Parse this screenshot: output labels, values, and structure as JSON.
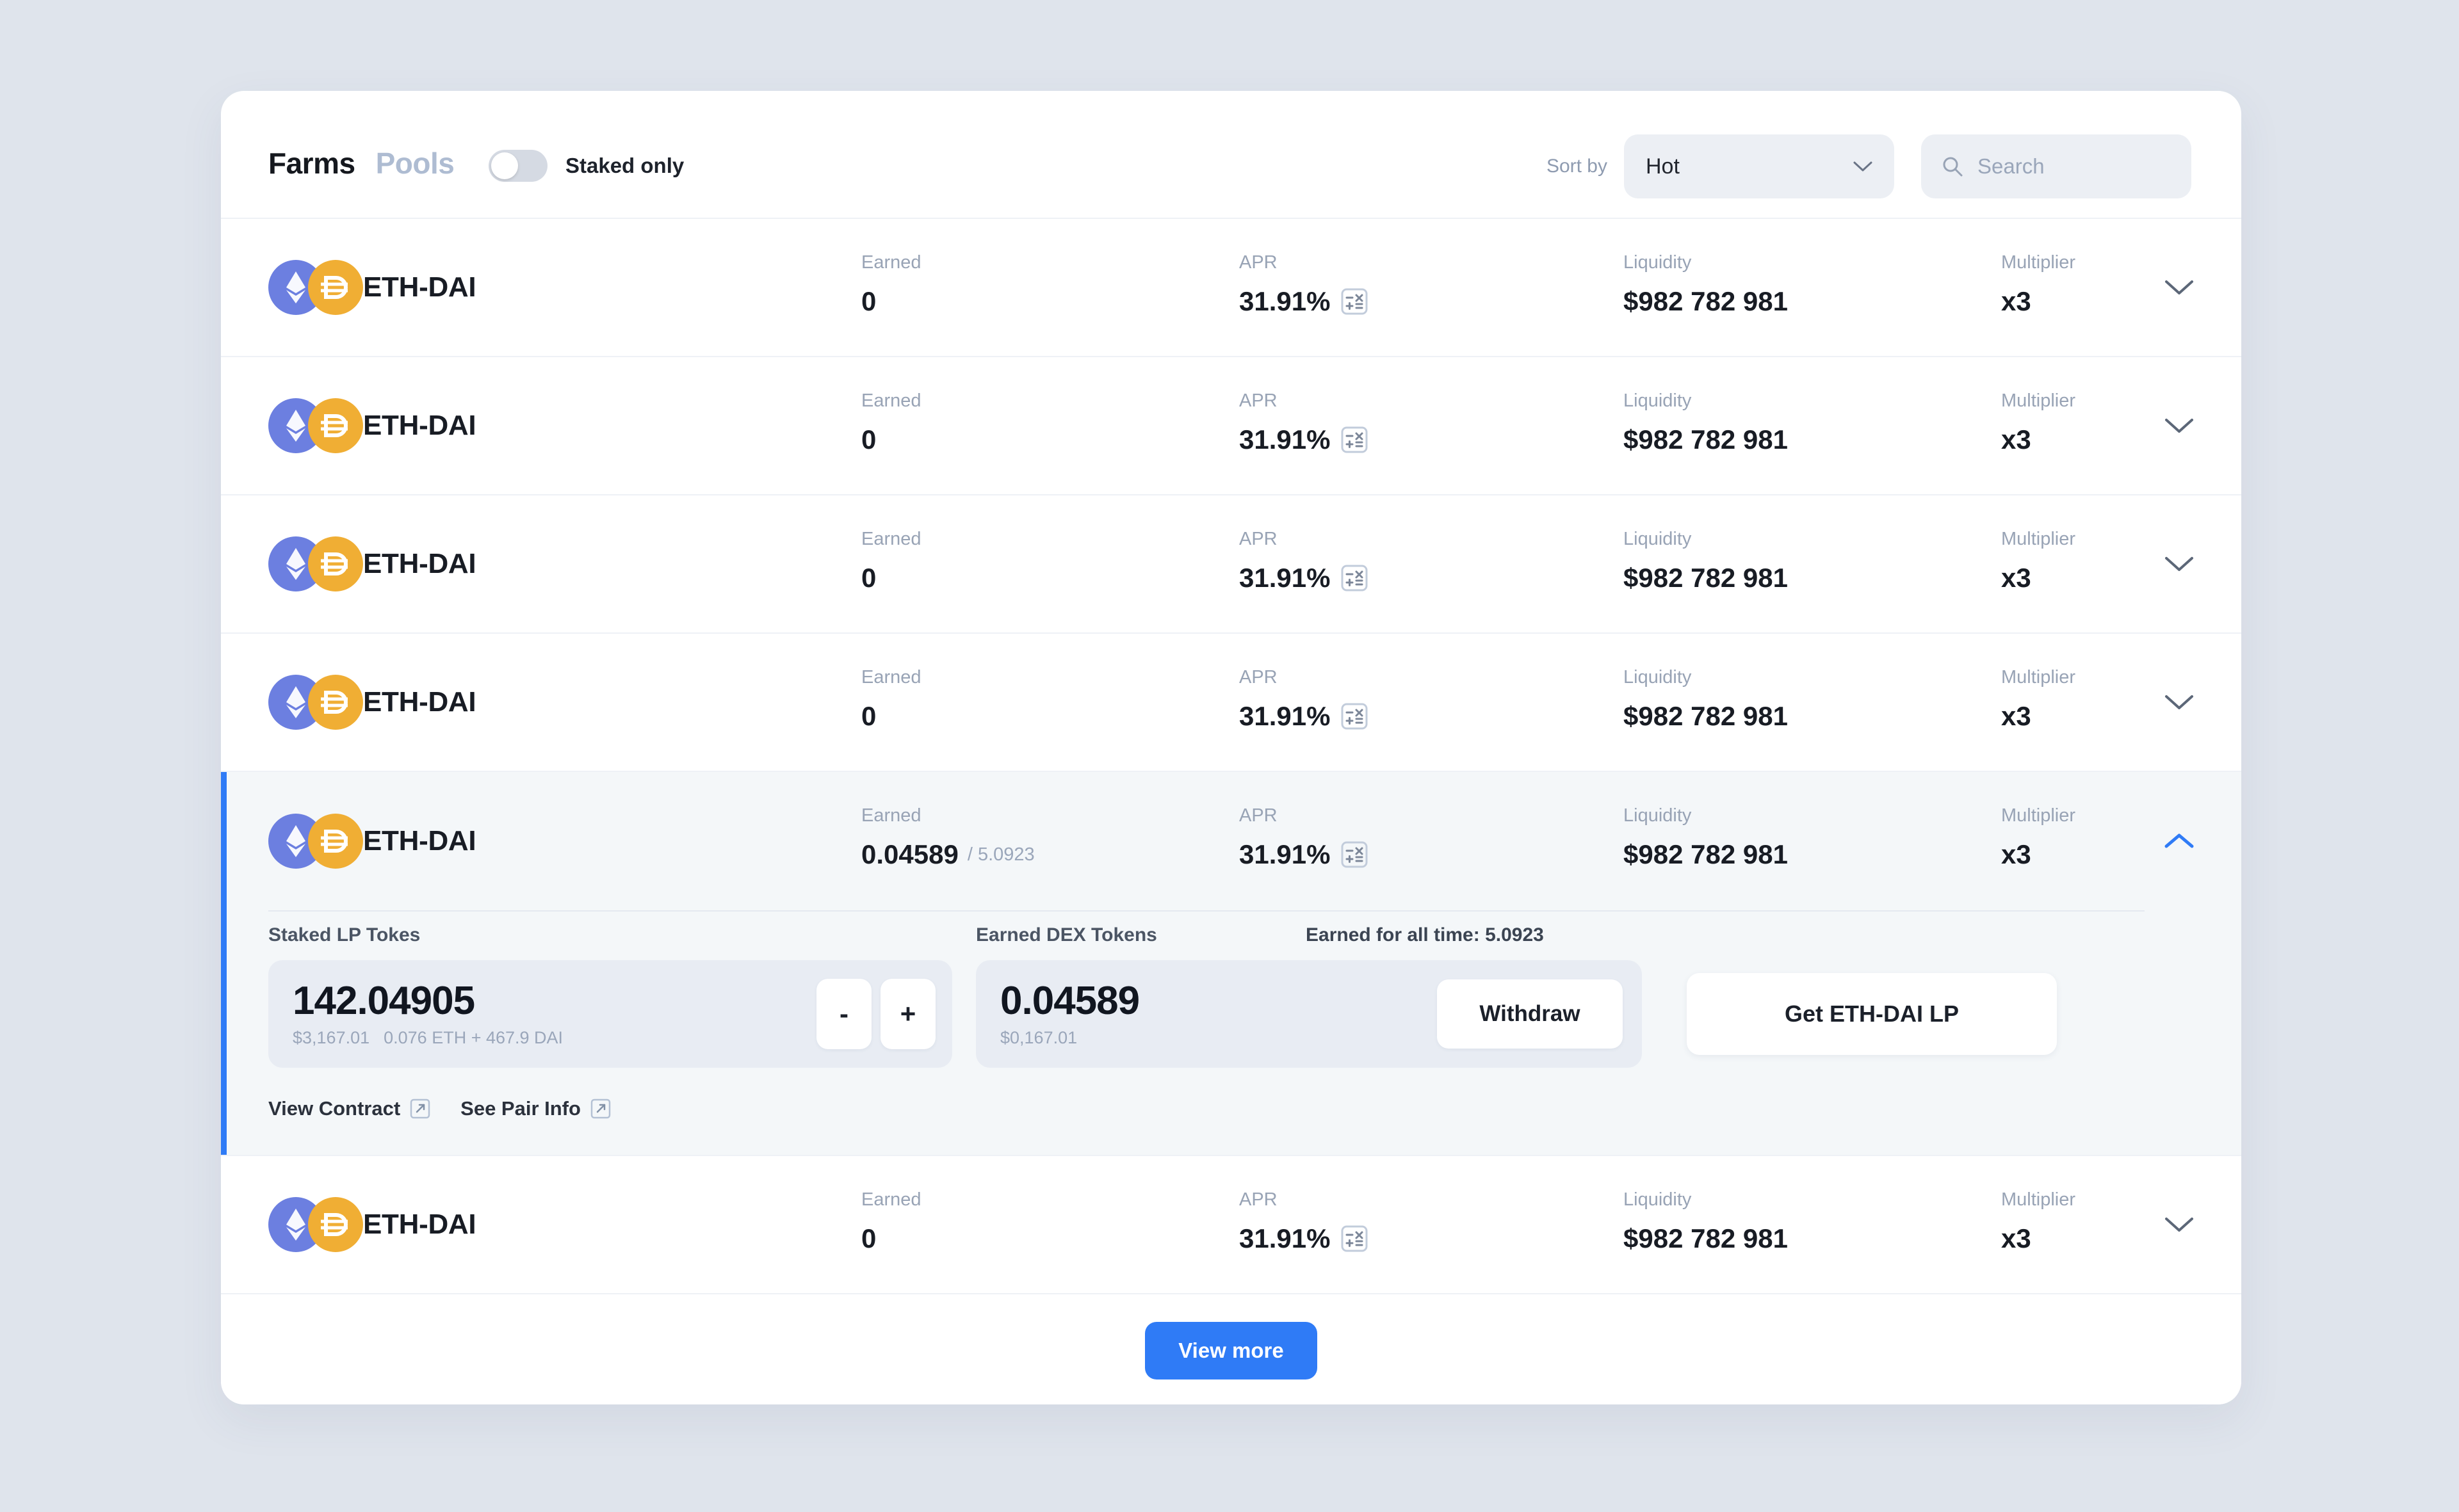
{
  "header": {
    "tab_farms": "Farms",
    "tab_pools": "Pools",
    "staked_only_label": "Staked only",
    "sort_by_label": "Sort by",
    "sort_value": "Hot",
    "search_placeholder": "Search"
  },
  "columns": {
    "earned": "Earned",
    "apr": "APR",
    "liquidity": "Liquidity",
    "multiplier": "Multiplier"
  },
  "rows": [
    {
      "pair": "ETH-DAI",
      "earned": "0",
      "earned_sub": "",
      "apr": "31.91%",
      "liquidity": "$982 782 981",
      "multiplier": "x3",
      "expanded": false
    },
    {
      "pair": "ETH-DAI",
      "earned": "0",
      "earned_sub": "",
      "apr": "31.91%",
      "liquidity": "$982 782 981",
      "multiplier": "x3",
      "expanded": false
    },
    {
      "pair": "ETH-DAI",
      "earned": "0",
      "earned_sub": "",
      "apr": "31.91%",
      "liquidity": "$982 782 981",
      "multiplier": "x3",
      "expanded": false
    },
    {
      "pair": "ETH-DAI",
      "earned": "0",
      "earned_sub": "",
      "apr": "31.91%",
      "liquidity": "$982 782 981",
      "multiplier": "x3",
      "expanded": false
    },
    {
      "pair": "ETH-DAI",
      "earned": "0.04589",
      "earned_sub": "/ 5.0923",
      "apr": "31.91%",
      "liquidity": "$982 782 981",
      "multiplier": "x3",
      "expanded": true
    },
    {
      "pair": "ETH-DAI",
      "earned": "0",
      "earned_sub": "",
      "apr": "31.91%",
      "liquidity": "$982 782 981",
      "multiplier": "x3",
      "expanded": false
    }
  ],
  "expanded_panel": {
    "staked_label": "Staked LP Tokes",
    "staked_amount": "142.04905",
    "staked_usd": "$3,167.01",
    "staked_breakdown": "0.076 ETH + 467.9 DAI",
    "minus_label": "-",
    "plus_label": "+",
    "earned_label": "Earned  DEX Tokens",
    "earned_all_time": "Earned for all time: 5.0923",
    "earned_amount": "0.04589",
    "earned_usd": "$0,167.01",
    "withdraw_label": "Withdraw",
    "get_lp_label": "Get ETH-DAI LP",
    "view_contract_label": "View Contract",
    "see_pair_info_label": "See Pair Info"
  },
  "footer": {
    "view_more_label": "View more"
  },
  "colors": {
    "accent": "#2f7bf6",
    "page_bg": "#dfe4ec",
    "eth": "#6c7fe0",
    "dai": "#f0ae34",
    "muted_text": "#98a3b5"
  }
}
